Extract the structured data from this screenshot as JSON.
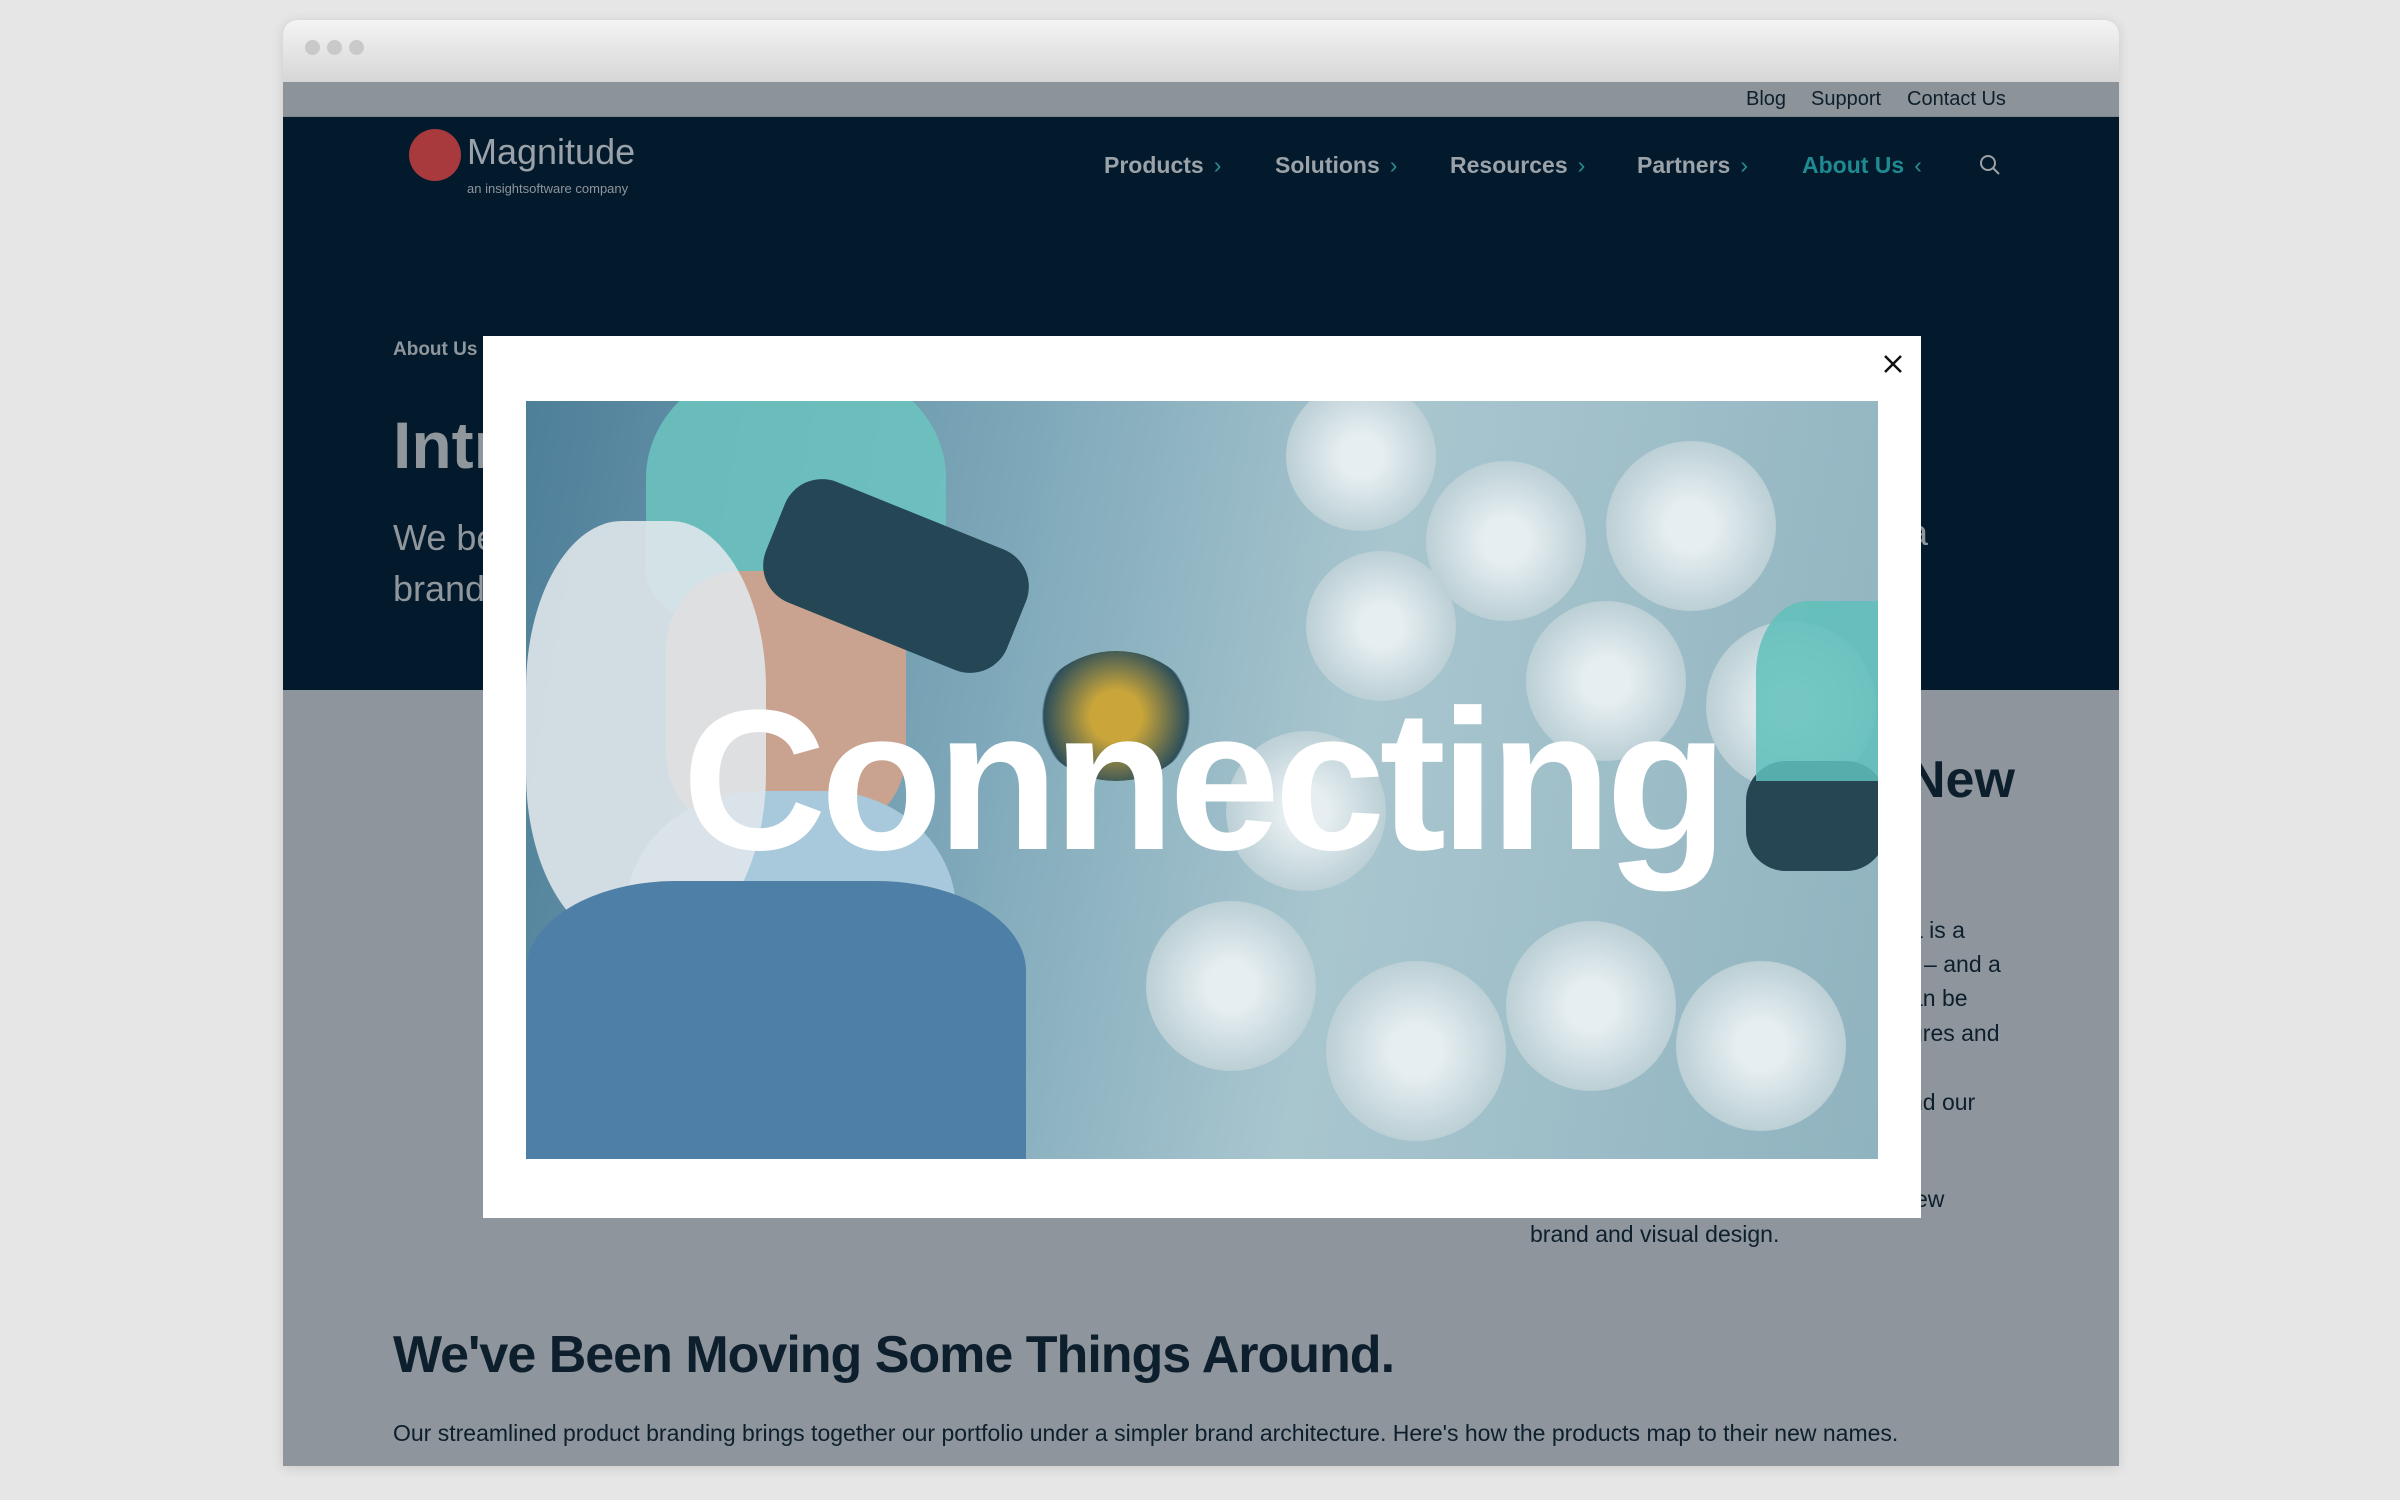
{
  "utility_nav": [
    "Blog",
    "Support",
    "Contact Us"
  ],
  "logo": {
    "name": "Magnitude",
    "tagline": "an insightsoftware company",
    "brand_color": "#c0392b"
  },
  "nav": {
    "items": [
      {
        "label": "Products"
      },
      {
        "label": "Solutions"
      },
      {
        "label": "Resources"
      },
      {
        "label": "Partners"
      },
      {
        "label": "About Us",
        "active": true
      }
    ],
    "accent": "#1f8a92"
  },
  "hero": {
    "breadcrumb": "About Us",
    "title": "Intr",
    "text_line1": "We be",
    "text_line2": "brand",
    "text_right": "a"
  },
  "section_right": {
    "heading": "New",
    "lines": [
      "a is a",
      "r – and a",
      "an be",
      "ures and",
      "nd our",
      "ew",
      "brand and visual design."
    ]
  },
  "section2": {
    "heading": "We've Been Moving Some Things Around.",
    "text": "Our streamlined product branding brings together our portfolio under a simpler brand architecture. Here's how the products map to their new names."
  },
  "modal": {
    "caption": "Connecting",
    "close_icon": "close-icon"
  }
}
